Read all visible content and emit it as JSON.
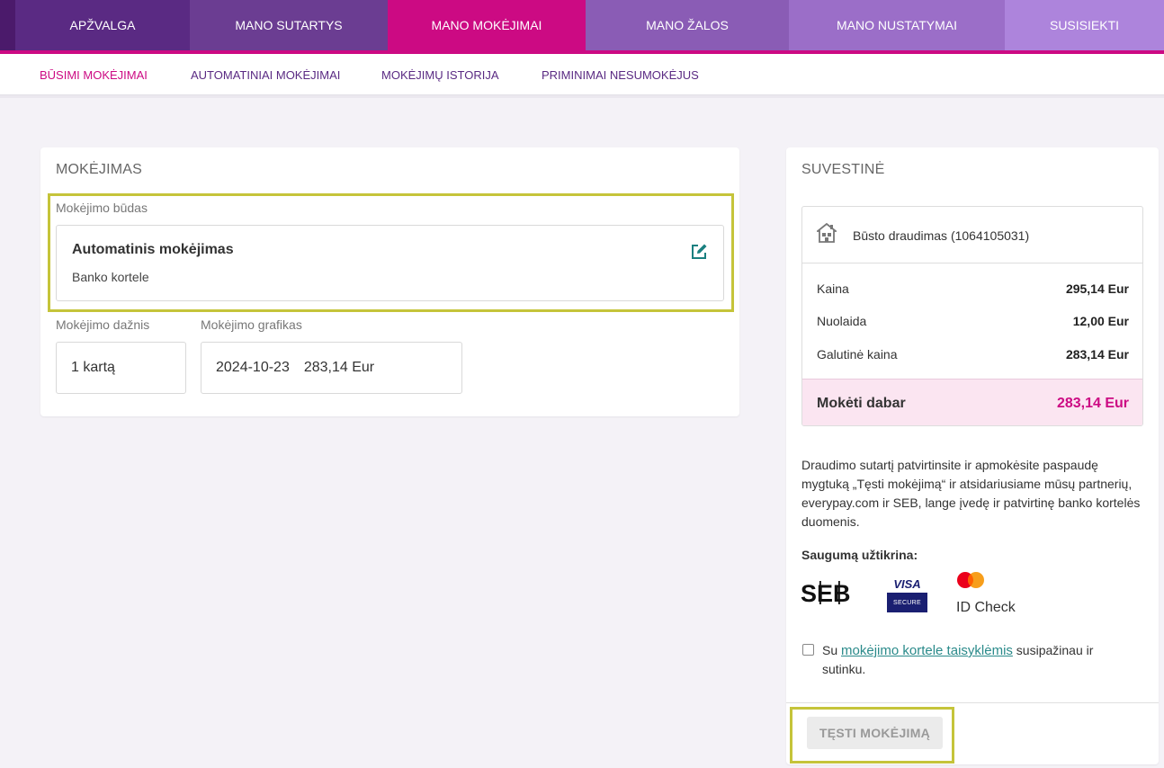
{
  "topnav": {
    "tabs": [
      {
        "label": "APŽVALGA"
      },
      {
        "label": "MANO SUTARTYS"
      },
      {
        "label": "MANO MOKĖJIMAI"
      },
      {
        "label": "MANO ŽALOS"
      },
      {
        "label": "MANO NUSTATYMAI"
      },
      {
        "label": "SUSISIEKTI"
      }
    ],
    "active_index": 2,
    "colors": {
      "active": "#cc0a83",
      "base": "#5a2a83"
    }
  },
  "subnav": {
    "items": [
      {
        "label": "BŪSIMI MOKĖJIMAI"
      },
      {
        "label": "AUTOMATINIAI MOKĖJIMAI"
      },
      {
        "label": "MOKĖJIMŲ ISTORIJA"
      },
      {
        "label": "PRIMINIMAI NESUMOKĖJUS"
      }
    ],
    "active_index": 0
  },
  "payment": {
    "title": "MOKĖJIMAS",
    "method_label": "Mokėjimo būdas",
    "method_title": "Automatinis mokėjimas",
    "method_subtitle": "Banko kortele",
    "edit_icon": "edit-icon",
    "frequency_label": "Mokėjimo dažnis",
    "frequency_value": "1 kartą",
    "schedule_label": "Mokėjimo grafikas",
    "schedule_date": "2024-10-23",
    "schedule_amount": "283,14 Eur"
  },
  "summary": {
    "title": "SUVESTINĖ",
    "policy_icon": "house-icon",
    "policy": "Būsto draudimas (1064105031)",
    "rows": [
      {
        "label": "Kaina",
        "value": "295,14 Eur"
      },
      {
        "label": "Nuolaida",
        "value": "12,00 Eur"
      },
      {
        "label": "Galutinė kaina",
        "value": "283,14 Eur"
      }
    ],
    "pay_now_label": "Mokėti dabar",
    "pay_now_value": "283,14 Eur",
    "info": "Draudimo sutartį patvirtinsite ir apmokėsite paspaudę mygtuką „Tęsti mokėjimą“ ir atsidariusiame mūsų partnerių, everypay.com ir SEB, lange įvedę ir patvirtinę banko kortelės duomenis.",
    "security_title": "Saugumą užtikrina:",
    "logos": {
      "seb": "SEB",
      "visa": "VISA",
      "visa_sub": "SECURE",
      "idcheck": "ID Check"
    },
    "agree_prefix": "Su ",
    "agree_link": "mokėjimo kortele taisyklėmis",
    "agree_suffix": " susipažinau ir sutinku.",
    "agree_checked": false,
    "continue_button": "TĘSTI MOKĖJIMĄ",
    "accent": "#cc0a83",
    "link_color": "#2a8a8a"
  }
}
